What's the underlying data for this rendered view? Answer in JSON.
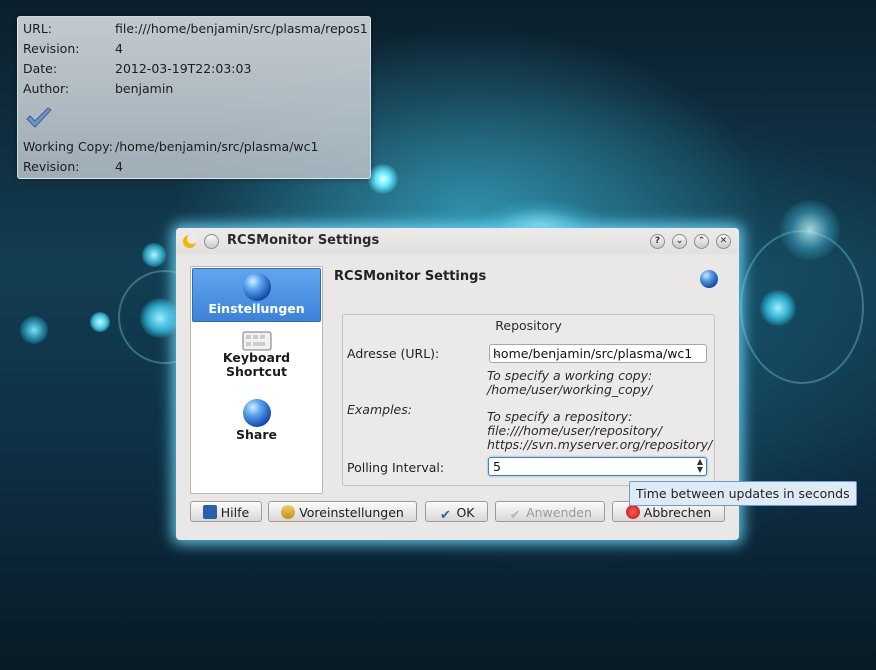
{
  "svn_info": {
    "url_label": "URL:",
    "url_value": "file:///home/benjamin/src/plasma/repos1",
    "revision_label": "Revision:",
    "revision_value": "4",
    "date_label": "Date:",
    "date_value": "2012-03-19T22:03:03",
    "author_label": "Author:",
    "author_value": "benjamin",
    "status_icon": "checkmark-icon",
    "wc_label": "Working Copy:",
    "wc_value": "/home/benjamin/src/plasma/wc1",
    "wc_revision_label": "Revision:",
    "wc_revision_value": "4"
  },
  "dialog": {
    "title": "RCSMonitor Settings",
    "titlebar_buttons": [
      "?",
      "⌄",
      "⌃",
      "✕"
    ],
    "sidebar": {
      "items": [
        {
          "label": "Einstellungen",
          "icon": "globe-icon",
          "active": true
        },
        {
          "label": "Keyboard Shortcut",
          "icon": "keyboard-icon",
          "active": false
        },
        {
          "label": "Share",
          "icon": "globe-icon",
          "active": false
        }
      ]
    },
    "page_title": "RCSMonitor Settings",
    "group_title": "Repository",
    "address_label": "Adresse (URL):",
    "address_value": "home/benjamin/src/plasma/wc1",
    "hint_working_copy_1": "To specify a working copy:",
    "hint_working_copy_2": "/home/user/working_copy/",
    "examples_label": "Examples:",
    "hint_repo_1": "To specify a repository:",
    "hint_repo_2": "file:///home/user/repository/",
    "hint_repo_3": "https://svn.myserver.org/repository/",
    "polling_label": "Polling Interval:",
    "polling_value": "5",
    "buttons": {
      "help": "Hilfe",
      "defaults": "Voreinstellungen",
      "ok": "OK",
      "apply": "Anwenden",
      "cancel": "Abbrechen"
    }
  },
  "tooltip": "Time between updates in seconds",
  "colors": {
    "accent": "#3c82d8",
    "tooltip_bg": "#dfeaf7",
    "desktop_glow": "#46c8e6"
  }
}
